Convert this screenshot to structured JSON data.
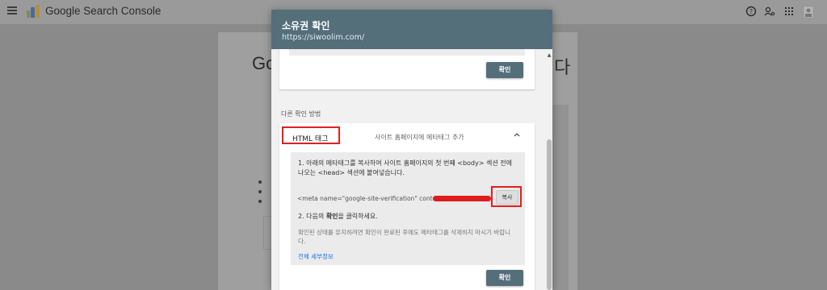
{
  "app": {
    "title": "Google Search Console",
    "icons": [
      "menu-icon",
      "help-icon",
      "user-settings-icon",
      "apps-grid-icon",
      "account-icon"
    ]
  },
  "background": {
    "heading_left": "Go",
    "heading_right": "다"
  },
  "dialog": {
    "title": "소유권 확인",
    "url": "https://siwoolim.com/",
    "top_card": {
      "verify_label": "확인"
    },
    "other_methods_label": "다른 확인 방법",
    "html_tag_card": {
      "label": "HTML 태그",
      "description": "사이트 홈페이지에 메타태그 추가",
      "chevron": "^",
      "step1": "1. 아래의 메타태그를 복사하여 사이트 홈페이지의 첫 번째 <body> 섹션 전에 나오는 <head> 섹션에 붙여넣습니다.",
      "meta_tag": "<meta name=\"google-site-verification\" content=",
      "copy_label": "복사",
      "step2_prefix": "2. 다음의 ",
      "step2_bold": "확인",
      "step2_suffix": "을 클릭하세요.",
      "note": "확인된 상태를 유지하려면 확인이 완료된 후에도 메타태그를 삭제하지 마시기 바랍니다.",
      "details_link": "전체 세부정보",
      "verify_label": "확인"
    }
  },
  "colors": {
    "dialog_header": "#546e7a",
    "button": "#546e7a",
    "highlight": "#e02020",
    "link": "#1a73e8"
  }
}
